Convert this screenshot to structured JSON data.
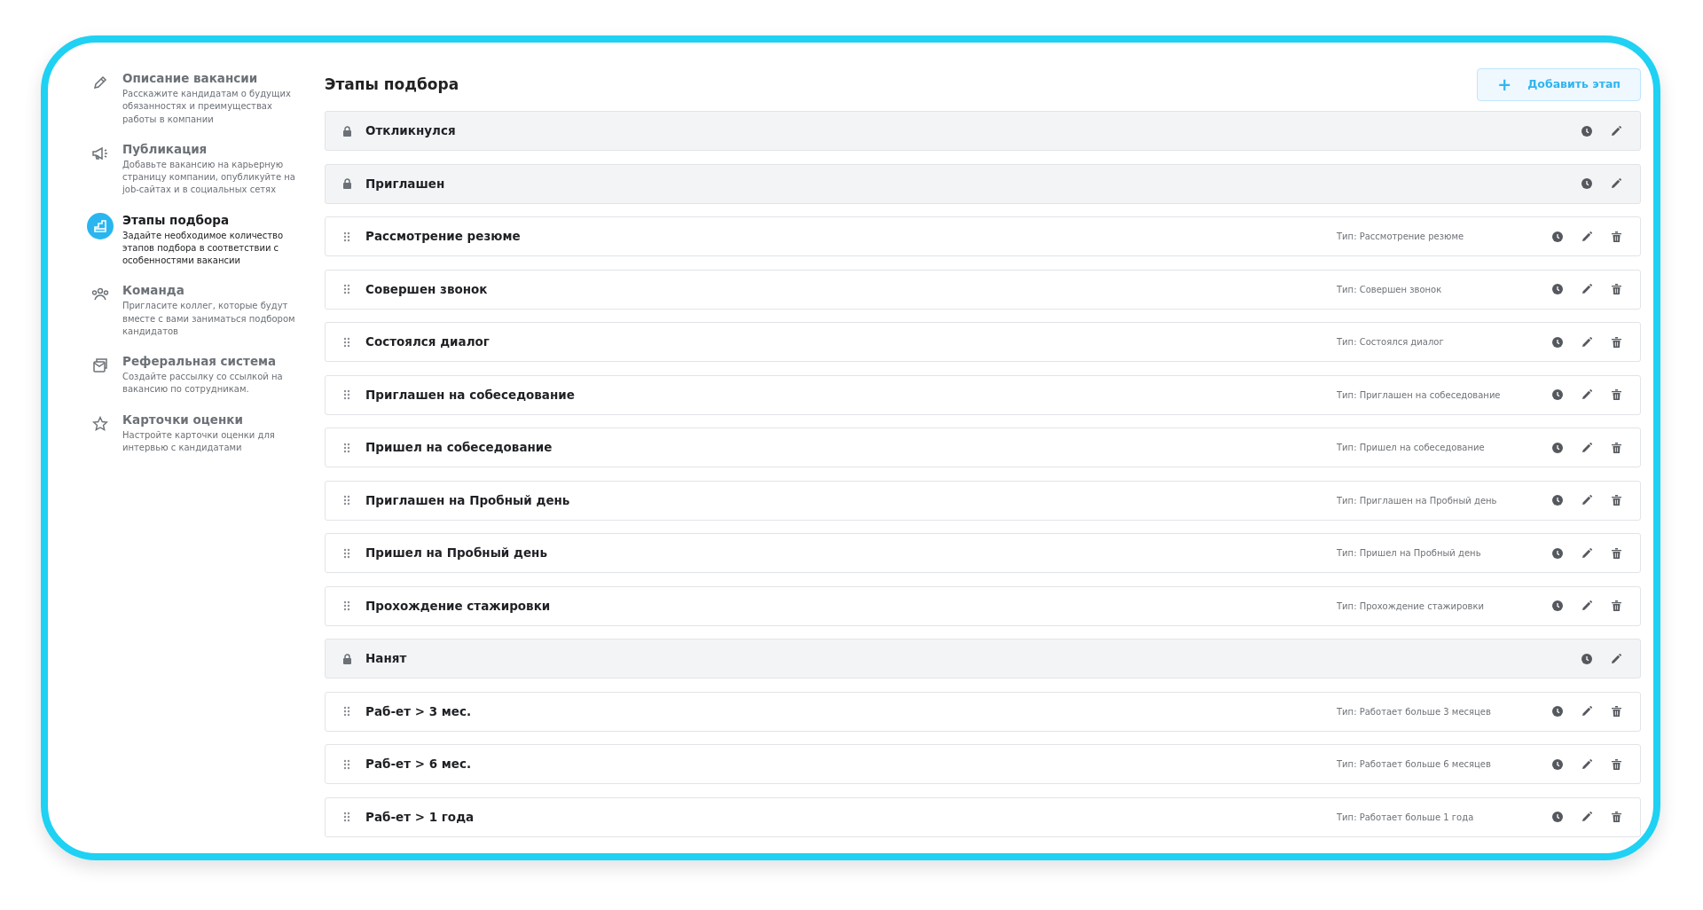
{
  "sidebar": {
    "items": [
      {
        "kind": "pencil",
        "title": "Описание вакансии",
        "description": "Расскажите кандидатам о будущих обязанностях и преимуществах работы в компании",
        "selected": false
      },
      {
        "kind": "megaphone",
        "title": "Публикация",
        "description": "Добавьте вакансию на карьерную страницу компании, опубликуйте на job-сайтах и в социальных сетях",
        "selected": false
      },
      {
        "kind": "stairs",
        "title": "Этапы подбора",
        "description": "Задайте необходимое количество этапов подбора в соответствии с особенностями вакансии",
        "selected": true
      },
      {
        "kind": "people",
        "title": "Команда",
        "description": "Пригласите коллег, которые будут вместе с вами заниматься подбором кандидатов",
        "selected": false
      },
      {
        "kind": "mail",
        "title": "Реферальная система",
        "description": "Создайте рассылку со ссылкой на вакансию по сотрудникам.",
        "selected": false
      },
      {
        "kind": "star",
        "title": "Карточки оценки",
        "description": "Настройте карточки оценки для интервью с кандидатами",
        "selected": false
      }
    ]
  },
  "page": {
    "title": "Этапы подбора",
    "add_button": {
      "icon": "+",
      "label": "Добавить этап"
    }
  },
  "stages": [
    {
      "kind": "locked",
      "name": "Откликнулся"
    },
    {
      "kind": "locked",
      "name": "Приглашен"
    },
    {
      "kind": "custom",
      "name": "Рассмотрение резюме",
      "type": "Тип: Рассмотрение резюме"
    },
    {
      "kind": "custom",
      "name": "Совершен звонок",
      "type": "Тип: Совершен звонок"
    },
    {
      "kind": "custom",
      "name": "Состоялся диалог",
      "type": "Тип: Состоялся диалог"
    },
    {
      "kind": "custom",
      "name": "Приглашен на собеседование",
      "type": "Тип: Приглашен на собеседование"
    },
    {
      "kind": "custom",
      "name": "Пришел на собеседование",
      "type": "Тип: Пришел на собеседование"
    },
    {
      "kind": "custom",
      "name": "Приглашен на Пробный день",
      "type": "Тип: Приглашен на Пробный день"
    },
    {
      "kind": "custom",
      "name": "Пришел на Пробный день",
      "type": "Тип: Пришел на Пробный день"
    },
    {
      "kind": "custom",
      "name": "Прохождение стажировки",
      "type": "Тип: Прохождение стажировки"
    },
    {
      "kind": "locked",
      "name": "Нанят"
    },
    {
      "kind": "custom",
      "name": "Раб-ет > 3 мес.",
      "type": "Тип: Работает больше 3 месяцев"
    },
    {
      "kind": "custom",
      "name": "Раб-ет > 6 мес.",
      "type": "Тип: Работает больше 6 месяцев"
    },
    {
      "kind": "custom",
      "name": "Раб-ет > 1 года",
      "type": "Тип: Работает больше 1 года"
    }
  ]
}
